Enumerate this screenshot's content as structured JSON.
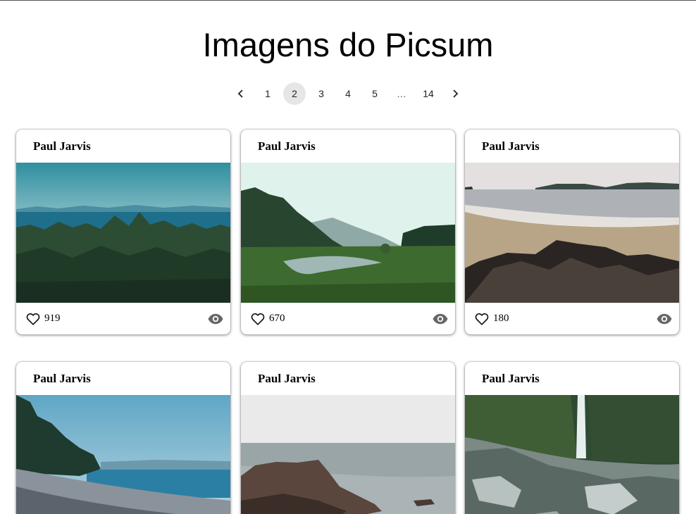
{
  "page": {
    "title": "Imagens do Picsum"
  },
  "pagination": {
    "prev_icon": "chevron-left-icon",
    "next_icon": "chevron-right-icon",
    "pages": [
      "1",
      "2",
      "3",
      "4",
      "5",
      "…",
      "14"
    ],
    "current": "2"
  },
  "cards": [
    {
      "author": "Paul Jarvis",
      "likes": "919",
      "like_icon": "heart-outline-icon",
      "view_icon": "eye-icon"
    },
    {
      "author": "Paul Jarvis",
      "likes": "670",
      "like_icon": "heart-outline-icon",
      "view_icon": "eye-icon"
    },
    {
      "author": "Paul Jarvis",
      "likes": "180",
      "like_icon": "heart-outline-icon",
      "view_icon": "eye-icon"
    },
    {
      "author": "Paul Jarvis"
    },
    {
      "author": "Paul Jarvis"
    },
    {
      "author": "Paul Jarvis"
    }
  ],
  "colors": {
    "active_page_bg": "#e6e6e6",
    "eye_icon": "#666666"
  }
}
